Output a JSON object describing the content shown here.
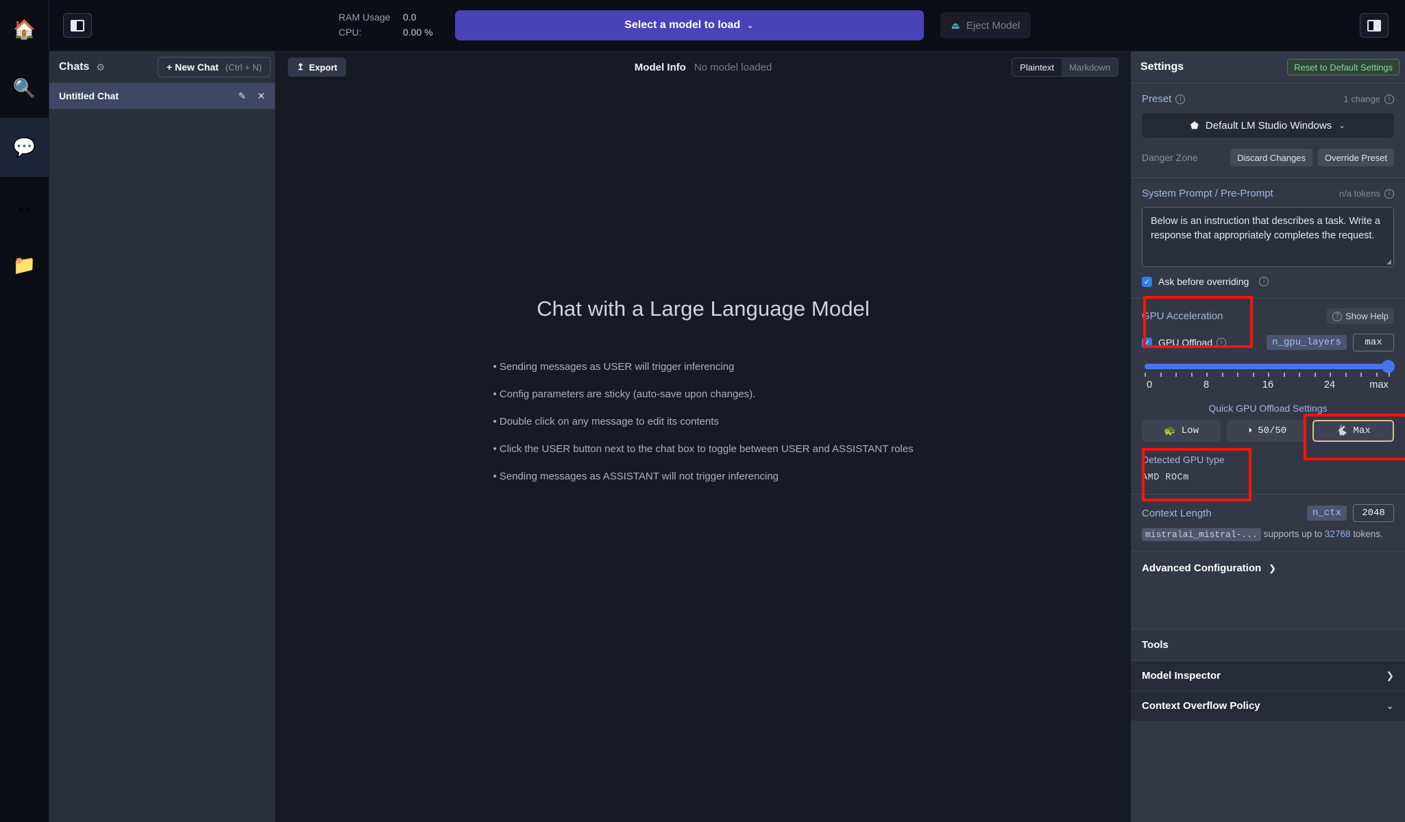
{
  "rail": {
    "items": [
      {
        "name": "home",
        "glyph": "🏠",
        "active": false
      },
      {
        "name": "search",
        "glyph": "🔍",
        "active": false
      },
      {
        "name": "chat",
        "glyph": "💬",
        "active": true
      },
      {
        "name": "server",
        "glyph": "↔",
        "active": false
      },
      {
        "name": "folder",
        "glyph": "📁",
        "active": false
      }
    ]
  },
  "topbar": {
    "ram_label": "RAM Usage",
    "ram_value": "0.0",
    "cpu_label": "CPU:",
    "cpu_value": "0.00 %",
    "model_select_label": "Select a model to load",
    "model_select_chevron": "⌄",
    "eject_label": "Eject Model",
    "eject_icon": "⏏"
  },
  "chats": {
    "title": "Chats",
    "gear_icon": "⚙",
    "new_chat_label": "+ New Chat",
    "new_chat_shortcut": "(Ctrl + N)",
    "items": [
      {
        "name": "Untitled Chat",
        "edit_icon": "✎",
        "close_icon": "✕",
        "selected": true
      }
    ]
  },
  "center": {
    "export_label": "Export",
    "export_icon": "↥",
    "model_info_label": "Model Info",
    "model_info_value": "No model loaded",
    "render_modes": [
      {
        "label": "Plaintext",
        "active": true
      },
      {
        "label": "Markdown",
        "active": false
      }
    ],
    "hero_title": "Chat with a Large Language Model",
    "bullets": [
      "Sending messages as USER will trigger inferencing",
      "Config parameters are sticky (auto-save upon changes).",
      "Double click on any message to edit its contents",
      "Click the USER button next to the chat box to toggle between USER and ASSISTANT roles",
      "Sending messages as ASSISTANT will not trigger inferencing"
    ]
  },
  "settings": {
    "title": "Settings",
    "reset_label": "Reset to Default Settings",
    "preset": {
      "label": "Preset",
      "changes_text": "1 change",
      "selected": "Default LM Studio Windows",
      "cube_icon": "⬟",
      "chevron": "⌄",
      "danger_label": "Danger Zone",
      "discard_label": "Discard Changes",
      "override_label": "Override Preset"
    },
    "system_prompt": {
      "label": "System Prompt / Pre-Prompt",
      "tokens_text": "n/a tokens",
      "value": "Below is an instruction that describes a task. Write a response that appropriately completes the request.",
      "ask_before_overriding_label": "Ask before overriding",
      "ask_before_overriding_checked": true
    },
    "gpu": {
      "label": "GPU Acceleration",
      "show_help_label": "Show Help",
      "offload_label": "GPU Offload",
      "offload_checked": true,
      "param_name": "n_gpu_layers",
      "param_value": "max",
      "slider_value": "max",
      "slider_ticks": [
        "0",
        "8",
        "16",
        "24",
        "max"
      ],
      "quick_title": "Quick GPU Offload Settings",
      "quick_buttons": [
        {
          "label": "Low",
          "icon": "🐢",
          "selected": false
        },
        {
          "label": "50/50",
          "icon": "◑",
          "selected": false
        },
        {
          "label": "Max",
          "icon": "🐇",
          "selected": true
        }
      ],
      "detected_label": "Detected GPU type",
      "detected_value": "AMD  ROCm"
    },
    "context": {
      "label": "Context Length",
      "param_name": "n_ctx",
      "param_value": "2048",
      "note_model": "mistralai_mistral-...",
      "note_mid": "supports up to",
      "note_num": "32768",
      "note_end": "tokens."
    },
    "advanced_label": "Advanced Configuration",
    "advanced_chevron": "❯",
    "tools_label": "Tools",
    "tool_rows": [
      {
        "label": "Model Inspector",
        "chevron": "❯"
      },
      {
        "label": "Context Overflow Policy",
        "chevron": "⌄"
      }
    ]
  },
  "colors": {
    "accent_purple": "#4a42b8",
    "accent_blue": "#4a74ef",
    "annotation_red": "#fc1408",
    "selected_gold": "#d9c38a",
    "green_reset": "#85d79a"
  }
}
